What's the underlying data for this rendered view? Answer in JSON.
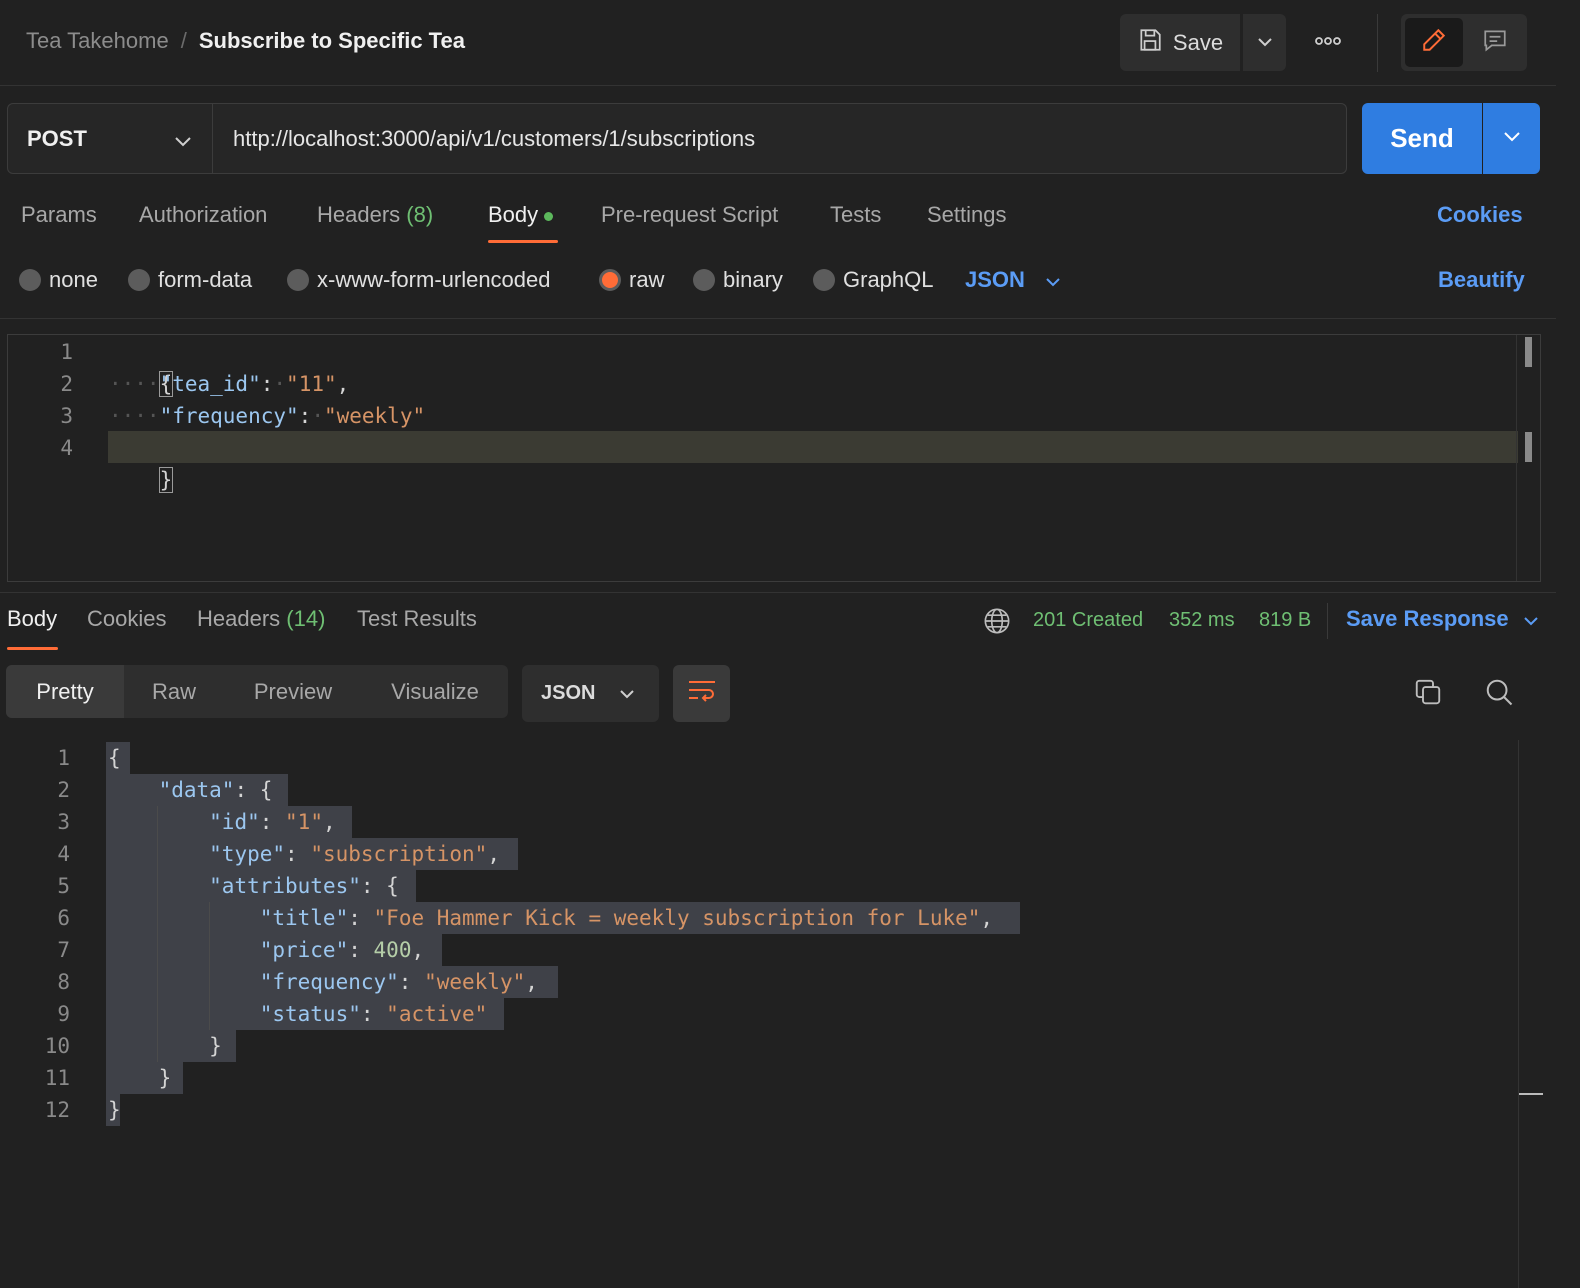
{
  "header": {
    "collection": "Tea Takehome",
    "separator": "/",
    "request_name": "Subscribe to Specific Tea",
    "save_label": "Save"
  },
  "request": {
    "method": "POST",
    "url": "http://localhost:3000/api/v1/customers/1/subscriptions",
    "send_label": "Send"
  },
  "request_tabs": {
    "params": "Params",
    "authorization": "Authorization",
    "headers": "Headers",
    "headers_count": "(8)",
    "body": "Body",
    "pre_request": "Pre-request Script",
    "tests": "Tests",
    "settings": "Settings",
    "cookies": "Cookies"
  },
  "body_types": {
    "none": "none",
    "form_data": "form-data",
    "urlencoded": "x-www-form-urlencoded",
    "raw": "raw",
    "binary": "binary",
    "graphql": "GraphQL",
    "language": "JSON",
    "beautify": "Beautify",
    "selected": "raw"
  },
  "request_body": {
    "line_numbers": [
      "1",
      "2",
      "3",
      "4"
    ],
    "l1_brace": "{",
    "l2_key": "\"tea_id\"",
    "l2_val": "\"11\"",
    "l3_key": "\"frequency\"",
    "l3_val": "\"weekly\"",
    "l4_brace": "}"
  },
  "response_tabs": {
    "body": "Body",
    "cookies": "Cookies",
    "headers": "Headers",
    "headers_count": "(14)",
    "test_results": "Test Results"
  },
  "response_meta": {
    "status": "201 Created",
    "time": "352 ms",
    "size": "819 B",
    "save_response": "Save Response"
  },
  "response_view": {
    "pretty": "Pretty",
    "raw": "Raw",
    "preview": "Preview",
    "visualize": "Visualize",
    "format": "JSON"
  },
  "response_body": {
    "line_numbers": [
      "1",
      "2",
      "3",
      "4",
      "5",
      "6",
      "7",
      "8",
      "9",
      "10",
      "11",
      "12"
    ],
    "open": "{",
    "data_key": "\"data\"",
    "id_key": "\"id\"",
    "id_val": "\"1\"",
    "type_key": "\"type\"",
    "type_val": "\"subscription\"",
    "attr_key": "\"attributes\"",
    "title_key": "\"title\"",
    "title_val": "\"Foe Hammer Kick = weekly subscription for Luke\"",
    "price_key": "\"price\"",
    "price_val": "400",
    "freq_key": "\"frequency\"",
    "freq_val": "\"weekly\"",
    "status_key": "\"status\"",
    "status_val": "\"active\"",
    "close": "}"
  },
  "colors": {
    "accent": "#ff6c37",
    "send": "#2f7de1",
    "link": "#5b9cf5",
    "success": "#6fbf73",
    "background": "#212121"
  }
}
